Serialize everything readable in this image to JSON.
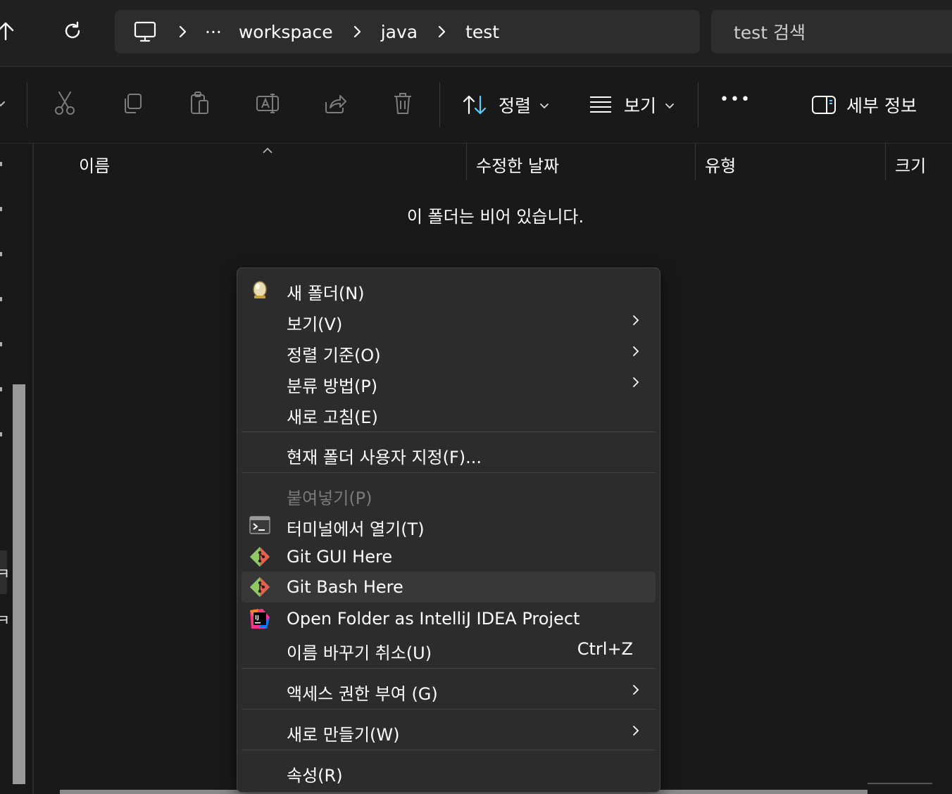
{
  "address": {
    "breadcrumbs": [
      "workspace",
      "java",
      "test"
    ],
    "overflow": "···",
    "search_placeholder": "test 검색"
  },
  "toolbar": {
    "sort_label": "정렬",
    "view_label": "보기",
    "more_label": "•••",
    "details_label": "세부 정보"
  },
  "columns": [
    "이름",
    "수정한 날짜",
    "유형",
    "크기"
  ],
  "empty_message": "이 폴더는 비어 있습니다.",
  "nav_pane": {
    "partial_chars": [
      "ㅋ",
      "ㅋ"
    ]
  },
  "context_menu": {
    "groups": [
      [
        {
          "label": "새 폴더(N)",
          "icon": "new-folder-icon",
          "submenu": false
        },
        {
          "label": "보기(V)",
          "submenu": true
        },
        {
          "label": "정렬 기준(O)",
          "submenu": true
        },
        {
          "label": "분류 방법(P)",
          "submenu": true
        },
        {
          "label": "새로 고침(E)",
          "submenu": false
        }
      ],
      [
        {
          "label": "현재 폴더 사용자 지정(F)...",
          "submenu": false
        }
      ],
      [
        {
          "label": "붙여넣기(P)",
          "disabled": true,
          "submenu": false
        },
        {
          "label": "터미널에서 열기(T)",
          "icon": "terminal-icon",
          "submenu": false
        },
        {
          "label": "Git GUI Here",
          "icon": "git-icon",
          "submenu": false
        },
        {
          "label": "Git Bash Here",
          "icon": "git-icon",
          "submenu": false,
          "hover": true
        },
        {
          "label": "Open Folder as IntelliJ IDEA Project",
          "icon": "intellij-icon",
          "submenu": false
        },
        {
          "label": "이름 바꾸기 취소(U)",
          "shortcut": "Ctrl+Z",
          "submenu": false
        }
      ],
      [
        {
          "label": "액세스 권한 부여 (G)",
          "submenu": true
        }
      ],
      [
        {
          "label": "새로 만들기(W)",
          "submenu": true
        }
      ],
      [
        {
          "label": "속성(R)",
          "submenu": false
        }
      ]
    ]
  },
  "colors": {
    "background": "#191919",
    "chrome": "#202020",
    "field": "#2d2d2d",
    "menu": "#2c2c2c",
    "accent_blue": "#60cdff"
  }
}
